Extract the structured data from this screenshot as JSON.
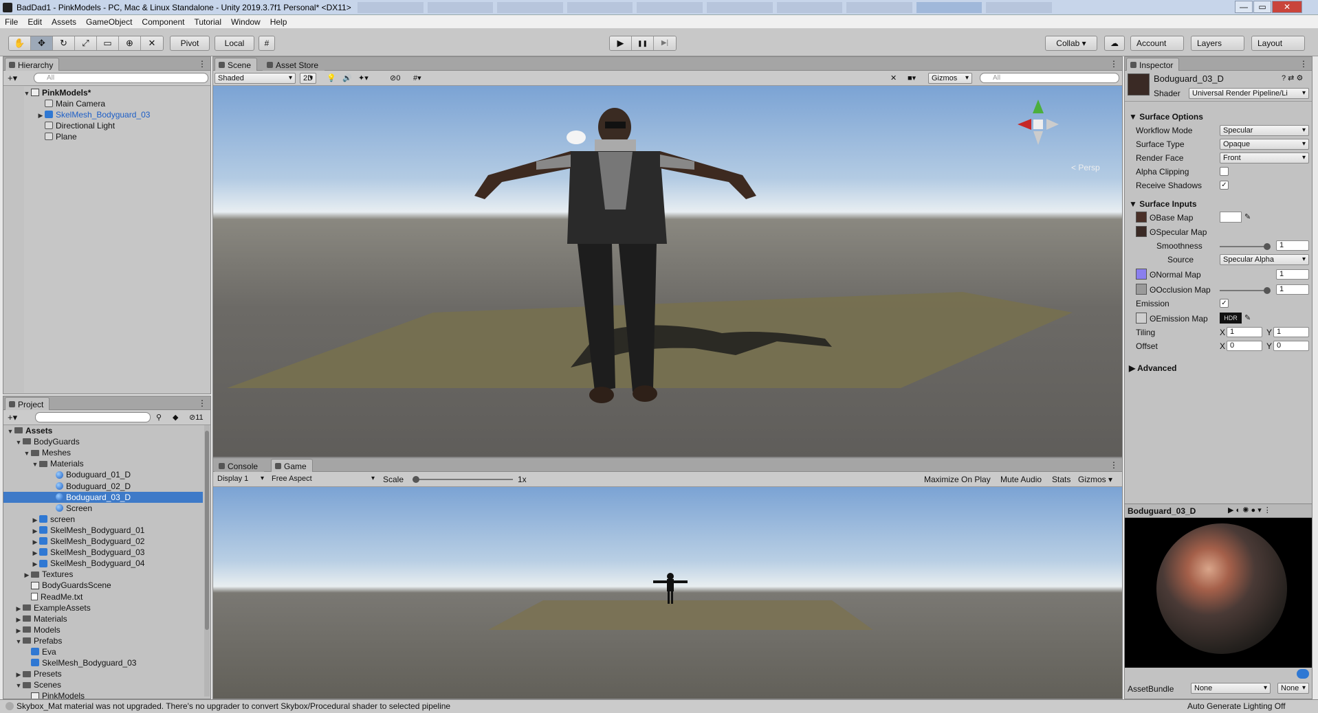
{
  "window": {
    "title": "BadDad1 - PinkModels - PC, Mac & Linux Standalone - Unity 2019.3.7f1 Personal* <DX11>",
    "min": "—",
    "max": "▭",
    "close": "✕"
  },
  "menu": [
    "File",
    "Edit",
    "Assets",
    "GameObject",
    "Component",
    "Tutorial",
    "Window",
    "Help"
  ],
  "toolbar": {
    "pivot": "Pivot",
    "local": "Local",
    "collab": "Collab ▾",
    "account": "Account",
    "layers": "Layers",
    "layout": "Layout",
    "play": "▶",
    "pause": "❚❚",
    "step": "▶|"
  },
  "hierarchy": {
    "tab": "Hierarchy",
    "search": "All",
    "scene": "PinkModels*",
    "items": [
      "Main Camera",
      "SkelMesh_Bodyguard_03",
      "Directional Light",
      "Plane"
    ]
  },
  "project": {
    "tab": "Project",
    "count": "11",
    "tree": [
      {
        "label": "Assets",
        "bold": true
      },
      {
        "label": "BodyGuards"
      },
      {
        "label": "Meshes"
      },
      {
        "label": "Materials"
      },
      {
        "label": "Boduguard_01_D"
      },
      {
        "label": "Boduguard_02_D"
      },
      {
        "label": "Boduguard_03_D"
      },
      {
        "label": "Screen"
      },
      {
        "label": "screen"
      },
      {
        "label": "SkelMesh_Bodyguard_01"
      },
      {
        "label": "SkelMesh_Bodyguard_02"
      },
      {
        "label": "SkelMesh_Bodyguard_03"
      },
      {
        "label": "SkelMesh_Bodyguard_04"
      },
      {
        "label": "Textures"
      },
      {
        "label": "BodyGuardsScene"
      },
      {
        "label": "ReadMe.txt"
      },
      {
        "label": "ExampleAssets"
      },
      {
        "label": "Materials"
      },
      {
        "label": "Models"
      },
      {
        "label": "Prefabs"
      },
      {
        "label": "Eva"
      },
      {
        "label": "SkelMesh_Bodyguard_03"
      },
      {
        "label": "Presets"
      },
      {
        "label": "Scenes"
      },
      {
        "label": "PinkModels"
      }
    ]
  },
  "scene": {
    "tabs": [
      "Scene",
      "Asset Store"
    ],
    "shading": "Shaded",
    "mode2d": "2D",
    "hidden_count": "0",
    "gizmos": "Gizmos",
    "search": "All",
    "persp": "< Persp"
  },
  "game": {
    "tabs": [
      "Console",
      "Game"
    ],
    "display": "Display 1",
    "aspect": "Free Aspect",
    "scale_label": "Scale",
    "scale_value": "1x",
    "maximize": "Maximize On Play",
    "mute": "Mute Audio",
    "stats": "Stats",
    "gizmos": "Gizmos"
  },
  "inspector": {
    "tab": "Inspector",
    "name": "Boduguard_03_D",
    "shader_label": "Shader",
    "shader": "Universal Render Pipeline/Li",
    "surface_options": "Surface Options",
    "workflow_label": "Workflow Mode",
    "workflow": "Specular",
    "surface_type_label": "Surface Type",
    "surface_type": "Opaque",
    "render_face_label": "Render Face",
    "render_face": "Front",
    "alpha_label": "Alpha Clipping",
    "shadows_label": "Receive Shadows",
    "surface_inputs": "Surface Inputs",
    "base_map": "Base Map",
    "specular_map": "Specular Map",
    "smoothness_label": "Smoothness",
    "smoothness": "1",
    "source_label": "Source",
    "source": "Specular Alpha",
    "normal_map": "Normal Map",
    "normal_value": "1",
    "occlusion_map": "Occlusion Map",
    "occlusion_value": "1",
    "emission_label": "Emission",
    "emission_map": "Emission Map",
    "hdr": "HDR",
    "tiling_label": "Tiling",
    "tiling_x": "1",
    "tiling_y": "1",
    "offset_label": "Offset",
    "offset_x": "0",
    "offset_y": "0",
    "x": "X",
    "y": "Y",
    "advanced": "Advanced",
    "preview_name": "Boduguard_03_D",
    "assetbundle_label": "AssetBundle",
    "assetbundle": "None",
    "assetbundle_variant": "None"
  },
  "status": {
    "message": "Skybox_Mat material was not upgraded. There's no upgrader to convert Skybox/Procedural shader to selected pipeline",
    "lighting": "Auto Generate Lighting Off"
  },
  "colors": {
    "selection": "#3e7ac8",
    "prefab": "#2f78d3",
    "normal_swatch": "#8a7fee"
  }
}
